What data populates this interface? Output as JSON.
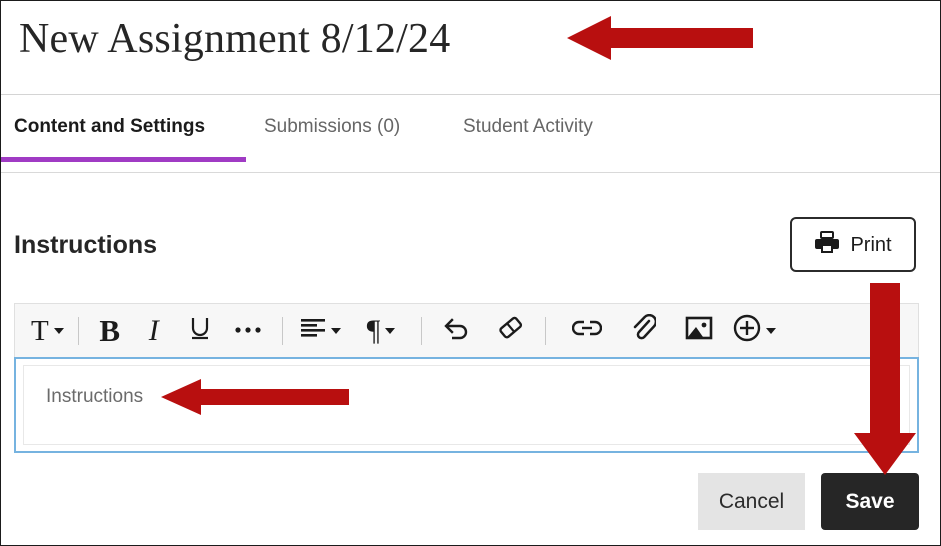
{
  "page": {
    "title": "New Assignment 8/12/24"
  },
  "tabs": [
    {
      "label": "Content and Settings",
      "active": true
    },
    {
      "label": "Submissions (0)",
      "active": false
    },
    {
      "label": "Student Activity",
      "active": false
    }
  ],
  "instructions_section": {
    "heading": "Instructions",
    "print_button": {
      "label": "Print",
      "icon": "printer-icon"
    }
  },
  "editor": {
    "toolbar": [
      {
        "name": "text-style-icon",
        "glyph": "T",
        "dropdown": true
      },
      {
        "name": "toolbar-separator-1",
        "glyph": "",
        "dropdown": false
      },
      {
        "name": "bold-icon",
        "glyph": "B",
        "dropdown": false
      },
      {
        "name": "italic-icon",
        "glyph": "I",
        "dropdown": false
      },
      {
        "name": "underline-icon",
        "glyph": "U",
        "dropdown": false
      },
      {
        "name": "more-options-icon",
        "glyph": "•••",
        "dropdown": false
      },
      {
        "name": "toolbar-separator-2",
        "glyph": "",
        "dropdown": false
      },
      {
        "name": "align-left-icon",
        "glyph": "",
        "dropdown": true
      },
      {
        "name": "paragraph-icon",
        "glyph": "¶",
        "dropdown": true
      },
      {
        "name": "toolbar-separator-3",
        "glyph": "",
        "dropdown": false
      },
      {
        "name": "undo-icon",
        "glyph": "",
        "dropdown": false
      },
      {
        "name": "clear-formatting-eraser-icon",
        "glyph": "",
        "dropdown": false
      },
      {
        "name": "toolbar-separator-4",
        "glyph": "",
        "dropdown": false
      },
      {
        "name": "link-icon",
        "glyph": "",
        "dropdown": false
      },
      {
        "name": "attachment-paperclip-icon",
        "glyph": "",
        "dropdown": false
      },
      {
        "name": "insert-image-icon",
        "glyph": "",
        "dropdown": false
      },
      {
        "name": "add-content-plus-icon",
        "glyph": "",
        "dropdown": true
      }
    ],
    "content_text": "Instructions"
  },
  "footer": {
    "cancel_label": "Cancel",
    "save_label": "Save"
  },
  "annotations": {
    "arrow_color": "#b80f0f",
    "title_arrow": "points-left-at-title",
    "editor_arrow": "points-left-at-instructions-text",
    "save_arrow": "points-down-at-save-button"
  },
  "colors": {
    "active_tab_underline": "#a03bc4",
    "save_button_bg": "#262626",
    "cancel_button_bg": "#e4e4e4",
    "editor_focus_border": "#76b3e0",
    "annotation_red": "#b80f0f"
  }
}
